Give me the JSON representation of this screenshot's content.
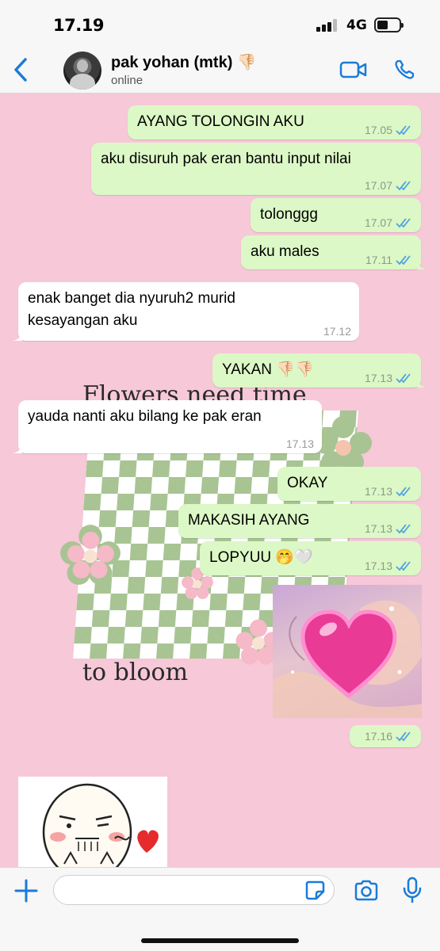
{
  "status_bar": {
    "time": "17.19",
    "network": "4G"
  },
  "header": {
    "contact_name": "pak yohan (mtk) 👎🏻",
    "contact_status": "online"
  },
  "wallpaper": {
    "title_top": "Flowers need time",
    "title_bottom": "to bloom"
  },
  "messages": [
    {
      "dir": "out",
      "text": "AYANG TOLONGIN AKU",
      "time": "17.05"
    },
    {
      "dir": "out",
      "text": "aku disuruh pak eran bantu input nilai",
      "time": "17.07"
    },
    {
      "dir": "out",
      "text": "tolonggg",
      "time": "17.07"
    },
    {
      "dir": "out",
      "text": "aku males",
      "time": "17.11"
    },
    {
      "dir": "in",
      "text": "enak banget dia nyuruh2 murid\nkesayangan aku",
      "time": "17.12"
    },
    {
      "dir": "out",
      "text": "YAKAN 👎🏻👎🏻",
      "time": "17.13"
    },
    {
      "dir": "in",
      "text": "yauda nanti aku bilang ke pak eran",
      "time": "17.13"
    },
    {
      "dir": "out",
      "text": "OKAY",
      "time": "17.13"
    },
    {
      "dir": "out",
      "text": "MAKASIH AYANG",
      "time": "17.13"
    },
    {
      "dir": "out",
      "text": "LOPYUU 🤭🤍",
      "time": "17.13"
    },
    {
      "dir": "out",
      "type": "image",
      "image": "heart-in-hands",
      "time": "17.16"
    },
    {
      "dir": "in",
      "type": "sticker",
      "image": "blushing-face-heart-sticker"
    }
  ],
  "input": {
    "placeholder": "",
    "value": ""
  },
  "colors": {
    "chat_bg": "#f6c8d8",
    "outgoing_bubble": "#dcf8c6",
    "incoming_bubble": "#ffffff",
    "read_ticks": "#4fa3e0",
    "accent": "#1a7bd8"
  }
}
